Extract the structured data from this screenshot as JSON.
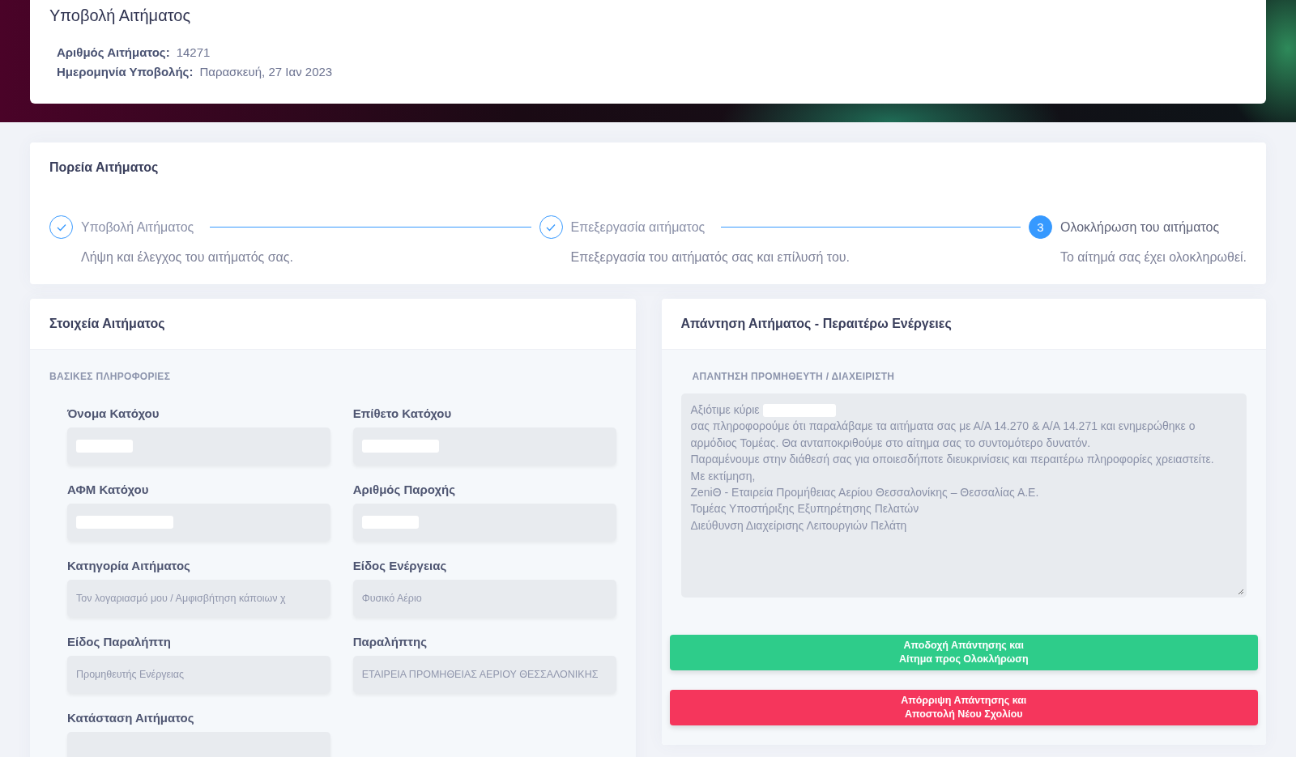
{
  "header": {
    "title": "Υποβολή Αιτήματος",
    "facts": [
      {
        "label": "Αριθμός Αιτήματος:",
        "value": "14271"
      },
      {
        "label": "Ημερομηνία Υποβολής:",
        "value": "Παρασκευή, 27 Ιαν 2023"
      }
    ]
  },
  "progress": {
    "title": "Πορεία Αιτήματος",
    "steps": [
      {
        "label": "Υποβολή Αιτήματος",
        "description": "Λήψη και έλεγχος του αιτήματός σας.",
        "completed": true
      },
      {
        "label": "Επεξεργασία αιτήματος",
        "description": "Επεξεργασία του αιτήματός σας και επίλυσή του.",
        "completed": true
      },
      {
        "label": "Ολοκλήρωση του αιτήματος",
        "description": "Το αίτημά σας έχει ολοκληρωθεί.",
        "completed": false,
        "number": "3"
      }
    ]
  },
  "details": {
    "title": "Στοιχεία Αιτήματος",
    "section": "ΒΑΣΙΚΕΣ ΠΛΗΡΟΦΟΡΙΕΣ",
    "fields": [
      {
        "label": "Όνομα Κατόχου",
        "redacted": true
      },
      {
        "label": "Επίθετο Κατόχου",
        "redacted": true
      },
      {
        "label": "ΑΦΜ Κατόχου",
        "redacted": true
      },
      {
        "label": "Αριθμός Παροχής",
        "redacted": true
      },
      {
        "label": "Κατηγορία Αιτήματος",
        "redacted": false,
        "value": "Τον λογαριασμό μου / Αμφισβήτηση κάποιων χ"
      },
      {
        "label": "Είδος Ενέργειας",
        "redacted": false,
        "value": "Φυσικό Αέριο"
      },
      {
        "label": "Είδος Παραλήπτη",
        "redacted": false,
        "value": "Προμηθευτής Ενέργειας"
      },
      {
        "label": "Παραλήπτης",
        "redacted": false,
        "value": "ΕΤΑΙΡΕΙΑ ΠΡΟΜΗΘΕΙΑΣ ΑΕΡΙΟΥ ΘΕΣΣΑΛΟΝΙΚΗΣ"
      },
      {
        "label": "Κατάσταση Αιτήματος",
        "redacted": false
      }
    ]
  },
  "response": {
    "title": "Απάντηση Αιτήματος - Περαιτέρω Ενέργειες",
    "section": "ΑΠΑΝΤΗΣΗ ΠΡΟΜΗΘΕΥΤΗ / ΔΙΑΧΕΙΡΙΣΤΗ",
    "lines": [
      {
        "text": "Αξιότιμε κύριε",
        "redacted": true
      },
      {
        "text": "σας πληροφορούμε ότι παραλάβαμε τα αιτήματα σας με Α/Α 14.270 & Α/Α 14.271 και ενημερώθηκε ο αρμόδιος Τομέας. Θα ανταποκριθούμε στο αίτημα σας το συντομότερο δυνατόν.",
        "redacted": false
      },
      {
        "text": "Παραμένουμε στην διάθεσή σας για οποιεσδήποτε διευκρινίσεις και περαιτέρω πληροφορίες χρειαστείτε.",
        "redacted": false
      },
      {
        "text": "Με εκτίμηση,",
        "redacted": false
      },
      {
        "text": "ZeniΘ - Εταιρεία Προμήθειας Αερίου Θεσσαλονίκης – Θεσσαλίας Α.Ε.",
        "redacted": false
      },
      {
        "text": "Τομέας Υποστήριξης Εξυπηρέτησης Πελατών",
        "redacted": false
      },
      {
        "text": "Διεύθυνση Διαχείρισης Λειτουργιών Πελάτη",
        "redacted": false
      }
    ],
    "buttons": [
      {
        "kind": "accept",
        "lines": [
          "Αποδοχή Απάντησης και",
          "Αίτημα προς Ολοκλήρωση"
        ]
      },
      {
        "kind": "reject",
        "lines": [
          "Απόρριψη Απάντησης και",
          "Αποστολή Νέου Σχολίου"
        ]
      }
    ]
  }
}
